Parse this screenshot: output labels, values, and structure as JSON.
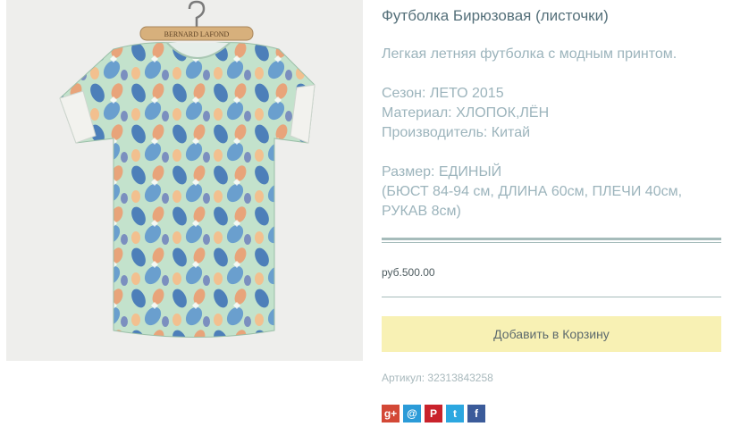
{
  "product": {
    "title": "Футболка Бирюзовая (листочки)",
    "description": "Легкая летняя футболка с модным принтом.",
    "season": "Сезон: ЛЕТО 2015",
    "material": "Материал: ХЛОПОК,ЛЁН",
    "manufacturer": "Производитель: Китай",
    "size": "Размер: ЕДИНЫЙ",
    "size_details_1": "(БЮСТ 84-94 см, ДЛИНА 60см, ПЛЕЧИ 40см,",
    "size_details_2": "РУКАВ 8см)",
    "price": "руб.500.00",
    "add_to_cart_label": "Добавить в Корзину",
    "sku": "Артикул: 32313843258",
    "hanger_label": "BERNARD LAFOND"
  },
  "colors": {
    "accent_button": "#f8f1b4",
    "divider": "#a6bcbb",
    "shirt_base": "#bfe0c8"
  },
  "social": [
    {
      "icon": "google-plus-icon",
      "glyph": "g+"
    },
    {
      "icon": "mail-ru-icon",
      "glyph": "@"
    },
    {
      "icon": "pinterest-icon",
      "glyph": "P"
    },
    {
      "icon": "twitter-icon",
      "glyph": "t"
    },
    {
      "icon": "facebook-icon",
      "glyph": "f"
    }
  ]
}
